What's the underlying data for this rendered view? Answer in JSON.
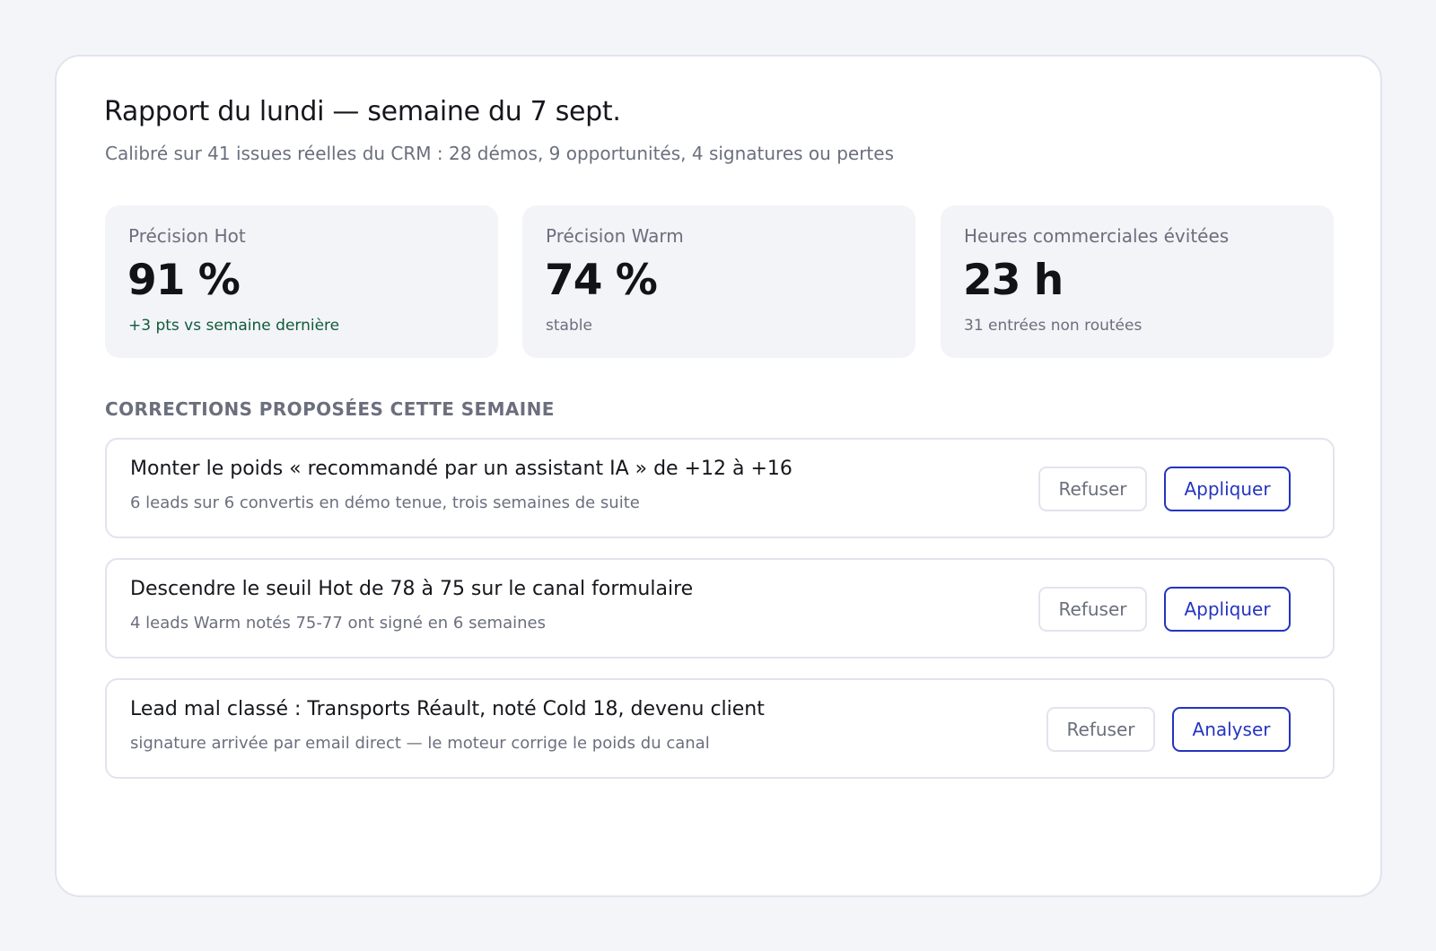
{
  "report": {
    "title": "Rapport du lundi — semaine du 7 sept.",
    "subtitle": "Calibré sur 41 issues réelles du CRM : 28 démos, 9 opportunités, 4 signatures ou pertes"
  },
  "metrics": [
    {
      "label": "Précision Hot",
      "value": "91 %",
      "note": "+3 pts vs semaine dernière"
    },
    {
      "label": "Précision Warm",
      "value": "74 %",
      "note": "stable"
    },
    {
      "label": "Heures commerciales évitées",
      "value": "23 h",
      "note": "31 entrées non routées"
    }
  ],
  "colors": {
    "positive": "#0f5b39",
    "accent": "#2434c0",
    "muted": "#6b6f7d"
  },
  "corrections": {
    "heading": "CORRECTIONS PROPOSÉES CETTE SEMAINE",
    "items": [
      {
        "title": "Monter le poids « recommandé par un assistant IA » de +12 à +16",
        "description": "6 leads sur 6 convertis en démo tenue, trois semaines de suite",
        "secondary_label": "Refuser",
        "primary_label": "Appliquer"
      },
      {
        "title": "Descendre le seuil Hot de 78 à 75 sur le canal formulaire",
        "description": "4 leads Warm notés 75-77 ont signé en 6 semaines",
        "secondary_label": "Refuser",
        "primary_label": "Appliquer"
      },
      {
        "title": "Lead mal classé : Transports Réault, noté Cold 18, devenu client",
        "description": "signature arrivée par email direct — le moteur corrige le poids du canal",
        "secondary_label": "Refuser",
        "primary_label": "Analyser"
      }
    ]
  }
}
